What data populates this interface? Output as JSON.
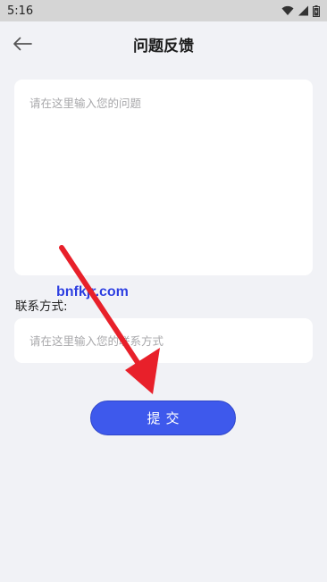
{
  "status_bar": {
    "time": "5:16",
    "icons": [
      "wifi-icon",
      "signal-icon",
      "battery-icon"
    ]
  },
  "header": {
    "back_icon": "arrow-left-icon",
    "title": "问题反馈"
  },
  "form": {
    "question_placeholder": "请在这里输入您的问题",
    "question_value": "",
    "contact_label": "联系方式:",
    "contact_placeholder": "请在这里输入您的联系方式",
    "contact_value": "",
    "submit_label": "提交"
  },
  "overlay": {
    "watermark_text": "bnfkjr.com",
    "arrow_color": "#e8202a"
  },
  "colors": {
    "background": "#f1f2f6",
    "accent": "#3e59ec",
    "status_bar": "#d5d5d5"
  }
}
